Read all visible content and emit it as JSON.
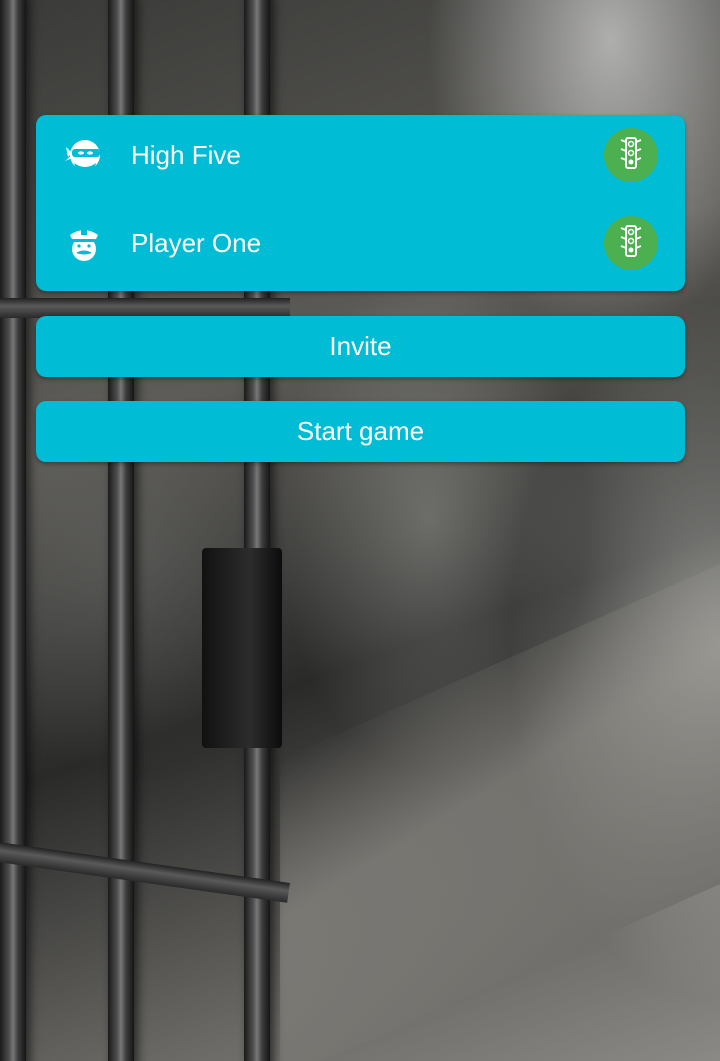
{
  "players": [
    {
      "name": "High Five",
      "avatar_icon": "ninja-icon",
      "status_icon": "traffic-light-icon"
    },
    {
      "name": "Player One",
      "avatar_icon": "police-officer-icon",
      "status_icon": "traffic-light-icon"
    }
  ],
  "actions": {
    "invite_label": "Invite",
    "start_label": "Start game"
  },
  "colors": {
    "accent": "#00bcd4",
    "status_ready": "#4caf50",
    "text": "#ffffff"
  }
}
